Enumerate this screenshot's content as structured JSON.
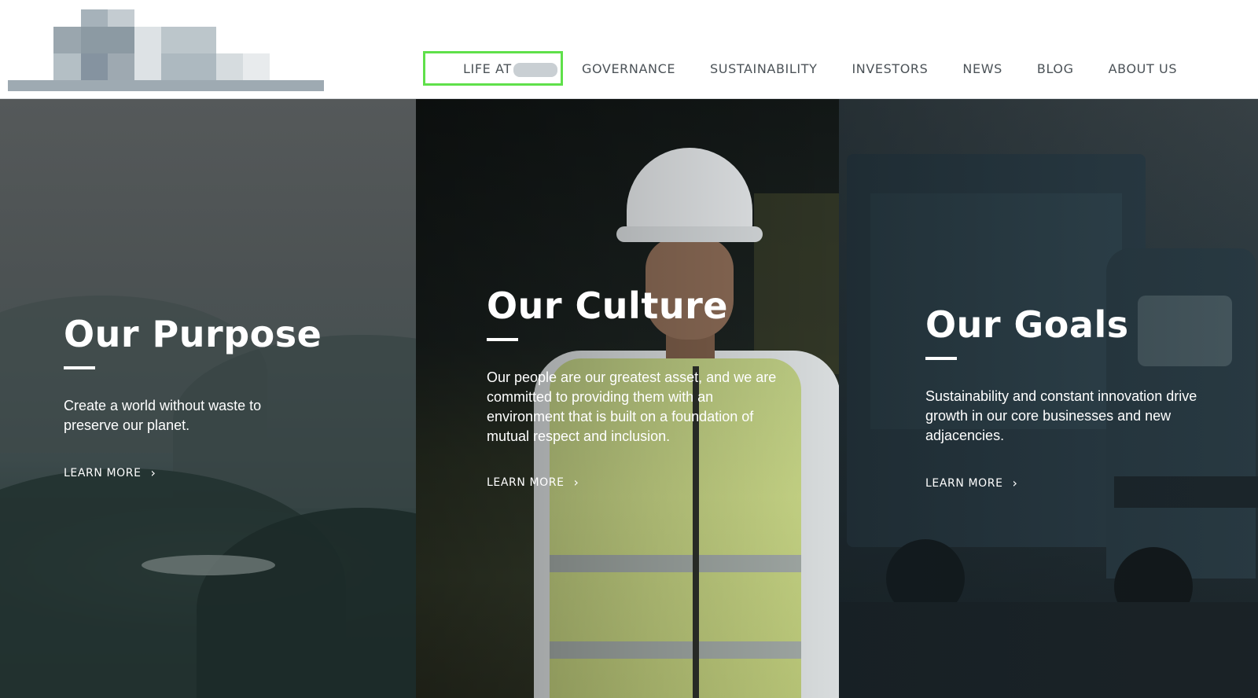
{
  "nav": {
    "items": [
      {
        "label": "LIFE AT"
      },
      {
        "label": "GOVERNANCE"
      },
      {
        "label": "SUSTAINABILITY"
      },
      {
        "label": "INVESTORS"
      },
      {
        "label": "NEWS"
      },
      {
        "label": "BLOG"
      },
      {
        "label": "ABOUT US"
      }
    ],
    "highlight_color": "#5fe04a"
  },
  "panels": [
    {
      "title": "Our Purpose",
      "text": "Create a world without waste to preserve our planet.",
      "cta": "LEARN MORE"
    },
    {
      "title": "Our Culture",
      "text": "Our people are our greatest asset, and we are committed to providing them with an environment that is built on a foundation of mutual respect and inclusion.",
      "cta": "LEARN MORE"
    },
    {
      "title": "Our Goals",
      "text": "Sustainability and constant innovation drive growth in our core businesses and new adjacencies.",
      "cta": "LEARN MORE"
    }
  ],
  "icons": {
    "chevron": "chevron-right-icon"
  }
}
